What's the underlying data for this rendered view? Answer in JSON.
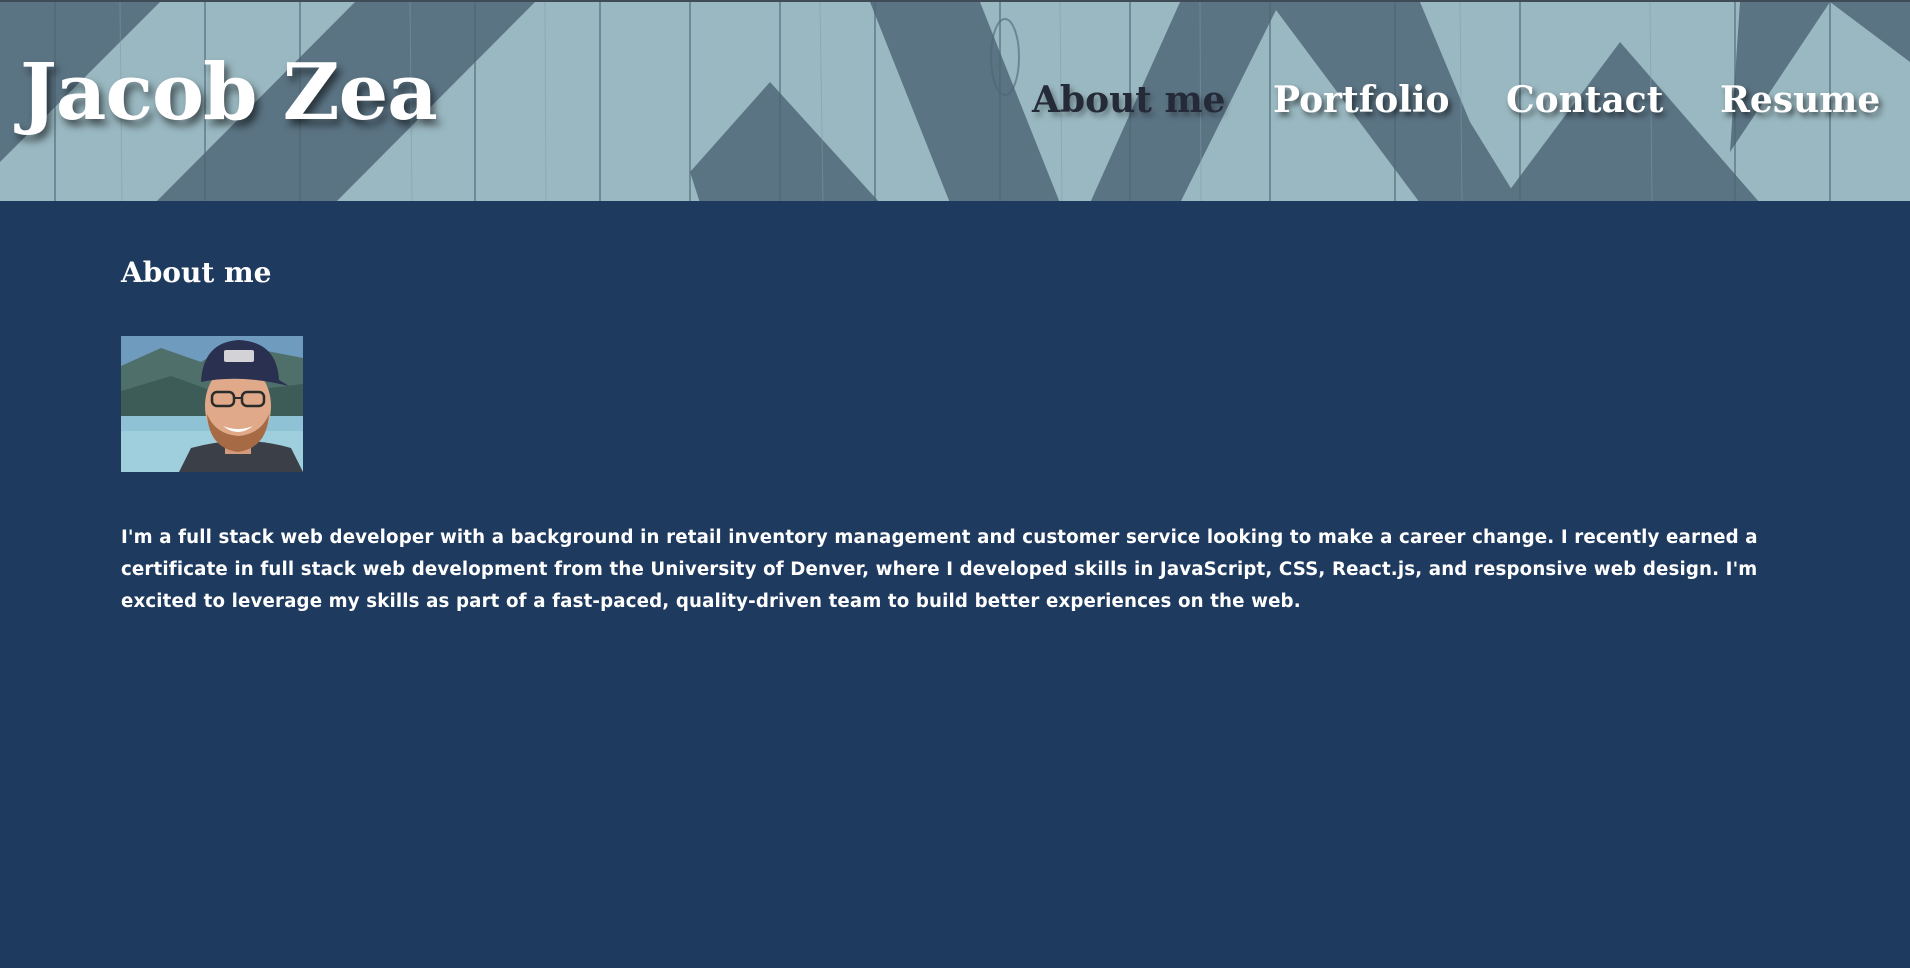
{
  "header": {
    "brand": "Jacob Zea"
  },
  "nav": {
    "items": [
      {
        "label": "About me",
        "active": true
      },
      {
        "label": "Portfolio",
        "active": false
      },
      {
        "label": "Contact",
        "active": false
      },
      {
        "label": "Resume",
        "active": false
      }
    ]
  },
  "about": {
    "title": "About me",
    "bio": "I'm a full stack web developer with a background in retail inventory management and customer service looking to make a career change. I recently earned a certificate in full stack web development from the University of Denver, where I developed skills in JavaScript, CSS, React.js, and responsive web design. I'm excited to leverage my skills as part of a fast-paced, quality-driven team to build better experiences on the web."
  },
  "colors": {
    "page_background": "#1f3a5f",
    "header_light": "#9ab8c1",
    "header_dark": "#5b7484",
    "active_nav": "#242a38",
    "text": "#ffffff"
  }
}
